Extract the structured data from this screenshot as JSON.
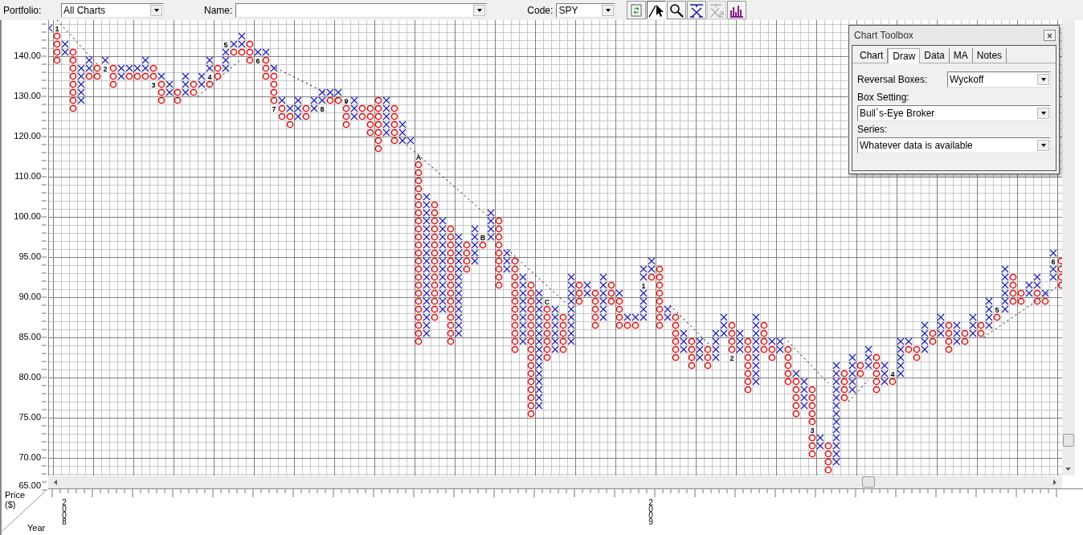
{
  "toolbar": {
    "portfolio": {
      "label": "Portfolio:",
      "value": "All Charts"
    },
    "name": {
      "label": "Name:"
    },
    "code": {
      "label": "Code:",
      "value": "SPY"
    },
    "tools": [
      {
        "kind": "refresh",
        "selected": false,
        "disabled": false
      },
      {
        "kind": "pointer",
        "selected": true,
        "disabled": false
      },
      {
        "kind": "zoom",
        "selected": false,
        "disabled": false
      },
      {
        "kind": "xbar",
        "selected": false,
        "disabled": false
      },
      {
        "kind": "x2",
        "selected": false,
        "disabled": true
      },
      {
        "kind": "histogram",
        "selected": false,
        "disabled": false
      }
    ]
  },
  "y_axis": {
    "labels": [
      "140.00",
      "130.00",
      "120.00",
      "110.00",
      "100.00",
      "95.00",
      "90.00",
      "85.00",
      "80.00",
      "75.00",
      "70.00",
      "65.00"
    ]
  },
  "pnf_chart": {
    "box_labels": [
      "1",
      "2",
      "3",
      "4",
      "5",
      "6",
      "7",
      "8",
      "9",
      "A",
      "B",
      "C",
      "1",
      "2",
      "3",
      "4",
      "5",
      "6"
    ]
  },
  "x_axis": {
    "years": [
      "2008",
      "2009"
    ]
  },
  "corner": {
    "price_label": "Price ($)",
    "year_label": "Year"
  },
  "toolbox": {
    "title": "Chart Toolbox",
    "tabs": [
      {
        "label": "Chart",
        "selected": false
      },
      {
        "label": "Draw",
        "selected": true
      },
      {
        "label": "Data",
        "selected": false
      },
      {
        "label": "MA",
        "selected": false
      },
      {
        "label": "Notes",
        "selected": false
      }
    ],
    "reversal": {
      "label": "Reversal Boxes:",
      "value": "Wyckoff"
    },
    "box_setting": {
      "label": "Box Setting:",
      "value": "Bull`s-Eye Broker"
    },
    "series": {
      "label": "Series:",
      "value": "Whatever data is available"
    }
  }
}
